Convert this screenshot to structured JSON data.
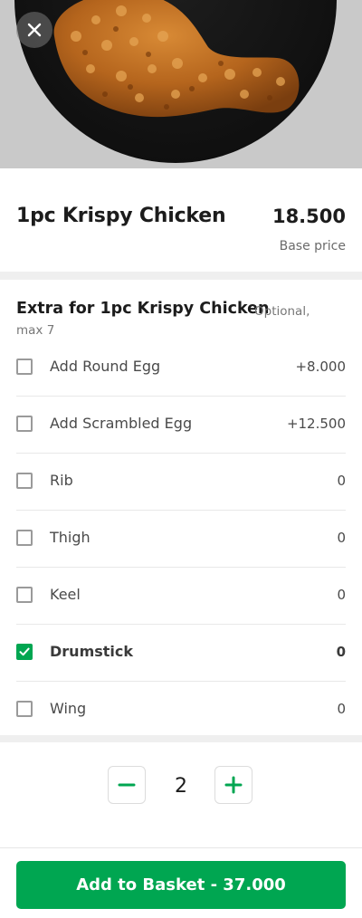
{
  "colors": {
    "accent": "#00a651",
    "hero_background": "#c9c9c9",
    "plate": "#111111",
    "chicken": "#b5651d"
  },
  "header": {
    "close_icon": "close-icon",
    "hero_image": "fried-chicken-drumstick-on-black-plate"
  },
  "product": {
    "name": "1pc Krispy Chicken",
    "price": "18.500",
    "price_caption": "Base price"
  },
  "extras": {
    "title": "Extra for 1pc Krispy Chicken",
    "optional_label": "Optional,",
    "max_label": "max 7",
    "options": [
      {
        "label": "Add Round Egg",
        "price": "+8.000",
        "checked": false
      },
      {
        "label": "Add Scrambled Egg",
        "price": "+12.500",
        "checked": false
      },
      {
        "label": "Rib",
        "price": "0",
        "checked": false
      },
      {
        "label": "Thigh",
        "price": "0",
        "checked": false
      },
      {
        "label": "Keel",
        "price": "0",
        "checked": false
      },
      {
        "label": "Drumstick",
        "price": "0",
        "checked": true
      },
      {
        "label": "Wing",
        "price": "0",
        "checked": false
      }
    ]
  },
  "quantity": {
    "value": "2",
    "minus_icon": "minus-icon",
    "plus_icon": "plus-icon"
  },
  "cta": {
    "label": "Add to Basket - 37.000"
  }
}
